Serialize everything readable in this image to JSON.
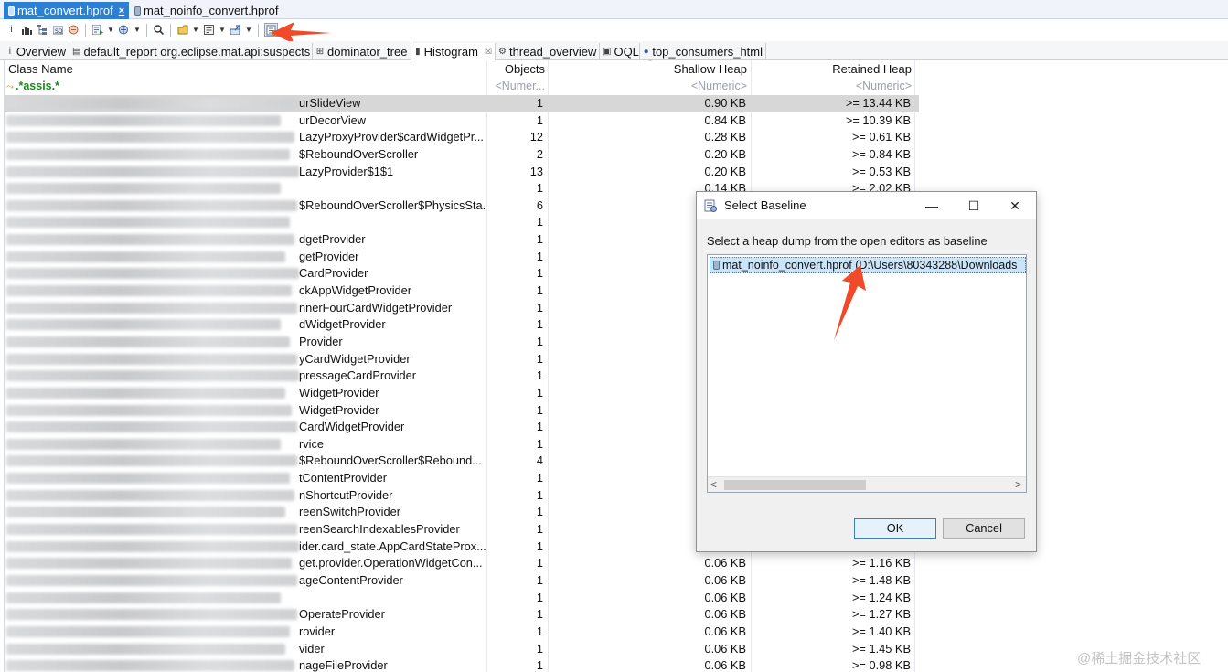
{
  "editor_tabs": [
    {
      "label": "mat_convert.hprof",
      "close": "×"
    },
    {
      "label": "mat_noinfo_convert.hprof"
    }
  ],
  "view_tabs": {
    "overview": "Overview",
    "default_report": "default_report  org.eclipse.mat.api:suspects",
    "dominator_tree": "dominator_tree",
    "histogram": "Histogram",
    "histogram_close": "☒",
    "thread_overview": "thread_overview",
    "oql": "OQL",
    "top_consumers": "top_consumers_html"
  },
  "table": {
    "headers": {
      "class_name": "Class Name",
      "objects": "Objects",
      "shallow": "Shallow Heap",
      "retained": "Retained Heap"
    },
    "filter": {
      "class_name": ".*assis.*",
      "objects": "<Numer...",
      "shallow": "<Numeric>",
      "retained": "<Numeric>"
    },
    "rows": [
      {
        "name": "urSlideView",
        "objects": "1",
        "shallow": "0.90 KB",
        "retained": ">= 13.44 KB"
      },
      {
        "name": "urDecorView",
        "objects": "1",
        "shallow": "0.84 KB",
        "retained": ">= 10.39 KB"
      },
      {
        "name": "LazyProxyProvider$cardWidgetPr...",
        "objects": "12",
        "shallow": "0.28 KB",
        "retained": ">= 0.61 KB"
      },
      {
        "name": "$ReboundOverScroller",
        "objects": "2",
        "shallow": "0.20 KB",
        "retained": ">= 0.84 KB"
      },
      {
        "name": "LazyProvider$1$1",
        "objects": "13",
        "shallow": "0.20 KB",
        "retained": ">= 0.53 KB"
      },
      {
        "name": "",
        "objects": "1",
        "shallow": "0.14 KB",
        "retained": ">= 2.02 KB"
      },
      {
        "name": "$ReboundOverScroller$PhysicsSta...",
        "objects": "6",
        "shallow": "",
        "retained": ""
      },
      {
        "name": "",
        "objects": "1",
        "shallow": "",
        "retained": ""
      },
      {
        "name": "dgetProvider",
        "objects": "1",
        "shallow": "",
        "retained": ""
      },
      {
        "name": "getProvider",
        "objects": "1",
        "shallow": "",
        "retained": ""
      },
      {
        "name": "CardProvider",
        "objects": "1",
        "shallow": "",
        "retained": ""
      },
      {
        "name": "ckAppWidgetProvider",
        "objects": "1",
        "shallow": "",
        "retained": ""
      },
      {
        "name": "nnerFourCardWidgetProvider",
        "objects": "1",
        "shallow": "",
        "retained": ""
      },
      {
        "name": "dWidgetProvider",
        "objects": "1",
        "shallow": "",
        "retained": ""
      },
      {
        "name": "Provider",
        "objects": "1",
        "shallow": "",
        "retained": ""
      },
      {
        "name": "yCardWidgetProvider",
        "objects": "1",
        "shallow": "",
        "retained": ""
      },
      {
        "name": "pressageCardProvider",
        "objects": "1",
        "shallow": "",
        "retained": ""
      },
      {
        "name": "WidgetProvider",
        "objects": "1",
        "shallow": "",
        "retained": ""
      },
      {
        "name": "WidgetProvider",
        "objects": "1",
        "shallow": "",
        "retained": ""
      },
      {
        "name": "CardWidgetProvider",
        "objects": "1",
        "shallow": "",
        "retained": ""
      },
      {
        "name": "rvice",
        "objects": "1",
        "shallow": "",
        "retained": ""
      },
      {
        "name": "$ReboundOverScroller$Rebound...",
        "objects": "4",
        "shallow": "",
        "retained": ""
      },
      {
        "name": "tContentProvider",
        "objects": "1",
        "shallow": "",
        "retained": ""
      },
      {
        "name": "nShortcutProvider",
        "objects": "1",
        "shallow": "",
        "retained": ""
      },
      {
        "name": "reenSwitchProvider",
        "objects": "1",
        "shallow": "",
        "retained": ""
      },
      {
        "name": "reenSearchIndexablesProvider",
        "objects": "1",
        "shallow": "",
        "retained": ""
      },
      {
        "name": "ider.card_state.AppCardStateProx...",
        "objects": "1",
        "shallow": "",
        "retained": ""
      },
      {
        "name": "get.provider.OperationWidgetCon...",
        "objects": "1",
        "shallow": "0.06 KB",
        "retained": ">= 1.16 KB"
      },
      {
        "name": "ageContentProvider",
        "objects": "1",
        "shallow": "0.06 KB",
        "retained": ">= 1.48 KB"
      },
      {
        "name": "",
        "objects": "1",
        "shallow": "0.06 KB",
        "retained": ">= 1.24 KB"
      },
      {
        "name": "OperateProvider",
        "objects": "1",
        "shallow": "0.06 KB",
        "retained": ">= 1.27 KB"
      },
      {
        "name": "rovider",
        "objects": "1",
        "shallow": "0.06 KB",
        "retained": ">= 1.40 KB"
      },
      {
        "name": "vider",
        "objects": "1",
        "shallow": "0.06 KB",
        "retained": ">= 1.45 KB"
      },
      {
        "name": "nageFileProvider",
        "objects": "1",
        "shallow": "0.06 KB",
        "retained": ">= 0.98 KB"
      }
    ]
  },
  "dialog": {
    "title": "Select Baseline",
    "message": "Select a heap dump from the open editors as baseline",
    "list_item": "mat_noinfo_convert.hprof (D:\\Users\\80343288\\Downloads",
    "ok": "OK",
    "cancel": "Cancel",
    "scroll_left": "<",
    "scroll_right": ">"
  },
  "watermark": "@稀土掘金技术社区",
  "colors": {
    "active_tab": "#2d7fd6",
    "annotation": "#f04a2a",
    "selection": "#cce4f7"
  }
}
